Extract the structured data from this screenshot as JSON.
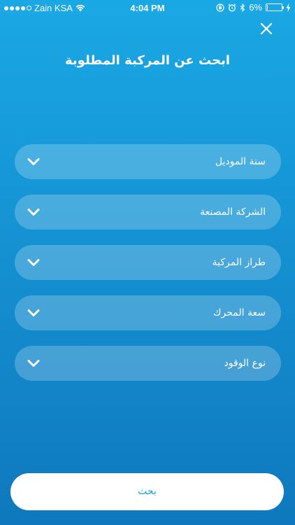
{
  "status_bar": {
    "carrier": "Zain KSA",
    "time": "4:04 PM",
    "battery_percent": "6%",
    "battery_level": 0.06,
    "signal_bars_filled": 4,
    "icons": [
      "signal-icon",
      "wifi-icon",
      "lock-rotation-icon",
      "alarm-icon",
      "bluetooth-icon",
      "battery-icon",
      "charging-icon"
    ]
  },
  "header": {
    "title": "ابحث عن المركبة المطلوبة",
    "close_icon": "close-icon"
  },
  "fields": [
    {
      "label": "سنة الموديل",
      "icon": "chevron-down-icon"
    },
    {
      "label": "الشركة المصنعة",
      "icon": "chevron-down-icon"
    },
    {
      "label": "طراز المركبة",
      "icon": "chevron-down-icon"
    },
    {
      "label": "سعة المحرك",
      "icon": "chevron-down-icon"
    },
    {
      "label": "نوع الوقود",
      "icon": "chevron-down-icon"
    }
  ],
  "search_button": {
    "label": "بحث"
  },
  "colors": {
    "background_top": "#1aa8e4",
    "background_bottom": "#0f78bd",
    "button_text": "#1a9fdf",
    "field_fill": "rgba(255,255,255,0.22)"
  }
}
